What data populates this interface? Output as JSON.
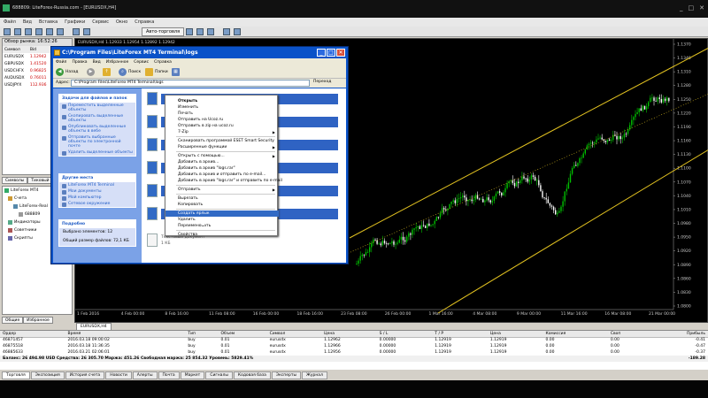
{
  "app": {
    "title": "688809: LiteForex-Russia.com - [EURUSDX,H4]",
    "menu": [
      "Файл",
      "Вид",
      "Вставка",
      "Графики",
      "Сервис",
      "Окно",
      "Справка"
    ],
    "autotrade_label": "Авто-торговля"
  },
  "market_watch": {
    "header": "Обзор рынка: 16:52:26",
    "columns": [
      "Символ",
      "Bid",
      "Ask"
    ],
    "rows": [
      {
        "symbol": "EURUSDX",
        "bid": "1.12942",
        "ask": "1.12942"
      },
      {
        "symbol": "GBPUSDX",
        "bid": "1.41520",
        "ask": "1.41520"
      },
      {
        "symbol": "USDCHFX",
        "bid": "0.96825",
        "ask": "0.96825"
      },
      {
        "symbol": "AUDUSDX",
        "bid": "0.76011",
        "ask": "0.76011"
      },
      {
        "symbol": "USDJPYX",
        "bid": "112.936",
        "ask": "112.936"
      }
    ],
    "tabs": [
      "Символы",
      "Тиковый график"
    ]
  },
  "navigator": {
    "items": [
      "LiteForex MT4",
      "Счета",
      "LiteForex-Real",
      "688809",
      "Индикаторы",
      "Советники",
      "Скрипты"
    ],
    "tabs": [
      "Общие",
      "Избранное"
    ]
  },
  "chart": {
    "title": "EURUSDX,H4  1.12933 1.12954 1.12892 1.12942",
    "tab": "EURUSDX,H4",
    "price_labels": [
      "1.1370",
      "1.1340",
      "1.1310",
      "1.1280",
      "1.1250",
      "1.1220",
      "1.1190",
      "1.1160",
      "1.1130",
      "1.1100",
      "1.1070",
      "1.1040",
      "1.1010",
      "1.0980",
      "1.0950",
      "1.0920",
      "1.0890",
      "1.0860",
      "1.0830",
      "1.0800"
    ],
    "time_labels": [
      "1 Feb 2016",
      "4 Feb 00:00",
      "8 Feb 16:00",
      "11 Feb 08:00",
      "16 Feb 00:00",
      "18 Feb 16:00",
      "23 Feb 08:00",
      "26 Feb 00:00",
      "1 Mar 16:00",
      "4 Mar 08:00",
      "9 Mar 00:00",
      "11 Mar 16:00",
      "16 Mar 08:00",
      "21 Mar 00:00"
    ],
    "colors": {
      "bull": "#00c000",
      "bear": "#ffffff",
      "channel": "#e0c020"
    }
  },
  "explorer": {
    "title": "C:\\Program Files\\LiteForex MT4 Terminal\\logs",
    "menu": [
      "Файл",
      "Правка",
      "Вид",
      "Избранное",
      "Сервис",
      "Справка"
    ],
    "back": "Назад",
    "search": "Поиск",
    "folders": "Папки",
    "address_label": "Адрес:",
    "address": "C:\\Program Files\\LiteForex MT4 Terminal\\logs",
    "go": "Переход",
    "file_tasks_title": "Задачи для файлов и папок",
    "file_tasks": [
      "Переместить выделенные объекты",
      "Скопировать выделенные объекты",
      "Опубликовать выделенные объекты в вебе",
      "Отправить выбранные объекты по электронной почте",
      "Удалить выделенные объекты"
    ],
    "other_title": "Другие места",
    "other_places": [
      "LiteForex MT4 Terminal",
      "Мои документы",
      "Мой компьютер",
      "Сетевое окружение"
    ],
    "details_title": "Подробно",
    "details_selected": "Выбрано элементов: 12",
    "details_size": "Общий размер файлов: 72,1 КБ",
    "file_caption": "Текстовый документ",
    "file_size": "1 КБ"
  },
  "context_menu": {
    "items": [
      {
        "label": "Открыть",
        "bold": true
      },
      {
        "label": "Изменить"
      },
      {
        "label": "Печать"
      },
      {
        "label": "Отправить на Ucoz.ru"
      },
      {
        "label": "Отправить в zip на ucoz.ru"
      },
      {
        "label": "7-Zip",
        "submenu": true
      },
      {
        "sep": true
      },
      {
        "label": "Сканировать программой ESET Smart Security"
      },
      {
        "label": "Расширенные функции",
        "submenu": true
      },
      {
        "sep": true
      },
      {
        "label": "Открыть с помощью...",
        "submenu": true
      },
      {
        "label": "Добавить в архив..."
      },
      {
        "label": "Добавить в архив \"logs.rar\""
      },
      {
        "label": "Добавить в архив и отправить по e-mail..."
      },
      {
        "label": "Добавить в архив \"logs.rar\" и отправить по e-mail"
      },
      {
        "sep": true
      },
      {
        "label": "Отправить",
        "submenu": true
      },
      {
        "sep": true
      },
      {
        "label": "Вырезать"
      },
      {
        "label": "Копировать"
      },
      {
        "sep": true
      },
      {
        "label": "Создать ярлык",
        "highlighted": true
      },
      {
        "label": "Удалить"
      },
      {
        "label": "Переименовать"
      },
      {
        "sep": true
      },
      {
        "label": "Свойства"
      }
    ]
  },
  "terminal": {
    "columns": [
      "Ордер",
      "Время",
      "Тип",
      "Объем",
      "Символ",
      "Цена",
      "S / L",
      "T / P",
      "Цена",
      "Комиссия",
      "Своп",
      "Прибыль"
    ],
    "rows": [
      [
        "46871457",
        "2016.03.18 09:00:02",
        "buy",
        "0.01",
        "eurusdx",
        "1.12962",
        "0.00000",
        "1.12919",
        "1.12919",
        "0.00",
        "0.00",
        "-0.41"
      ],
      [
        "46875518",
        "2016.03.18 11:36:35",
        "buy",
        "0.01",
        "eurusdx",
        "1.12966",
        "0.00000",
        "1.12919",
        "1.12919",
        "0.00",
        "0.00",
        "-0.47"
      ],
      [
        "46885633",
        "2016.03.21 02:06:01",
        "buy",
        "0.01",
        "eurusdx",
        "1.12956",
        "0.00000",
        "1.12919",
        "1.12919",
        "0.00",
        "0.00",
        "-0.37"
      ]
    ],
    "balance_line": "Баланс: 26 494.98 USD  Средства: 26 305.70  Маржа: 451.26  Свободная маржа: 25 854.32  Уровень: 5829.41%",
    "balance_profit": "-189.28",
    "tabs": [
      "Торговля",
      "Экспозиция",
      "История счета",
      "Новости",
      "Алерты",
      "Почта",
      "Маркет",
      "Сигналы",
      "Кодовая база",
      "Эксперты",
      "Журнал"
    ]
  }
}
